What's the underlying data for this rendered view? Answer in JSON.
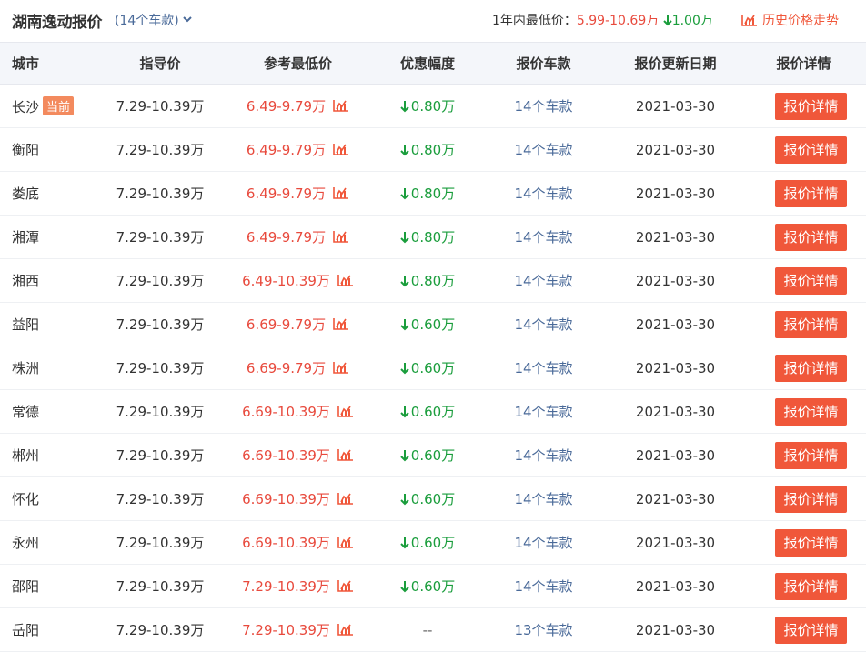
{
  "header": {
    "title": "湖南逸动报价",
    "models_count": "(14个车款)",
    "lowest_label": "1年内最低价：",
    "lowest_range": "5.99-10.69万",
    "lowest_drop": "1.00万",
    "history_label": "历史价格走势"
  },
  "table": {
    "columns": [
      "城市",
      "指导价",
      "参考最低价",
      "优惠幅度",
      "报价车款",
      "报价更新日期",
      "报价详情"
    ],
    "current_badge": "当前",
    "detail_label": "报价详情",
    "rows": [
      {
        "city": "长沙",
        "current": true,
        "guide": "7.29-10.39万",
        "ref": "6.49-9.79万",
        "discount": "0.80万",
        "has_discount": true,
        "models": "14个车款",
        "date": "2021-03-30"
      },
      {
        "city": "衡阳",
        "current": false,
        "guide": "7.29-10.39万",
        "ref": "6.49-9.79万",
        "discount": "0.80万",
        "has_discount": true,
        "models": "14个车款",
        "date": "2021-03-30"
      },
      {
        "city": "娄底",
        "current": false,
        "guide": "7.29-10.39万",
        "ref": "6.49-9.79万",
        "discount": "0.80万",
        "has_discount": true,
        "models": "14个车款",
        "date": "2021-03-30"
      },
      {
        "city": "湘潭",
        "current": false,
        "guide": "7.29-10.39万",
        "ref": "6.49-9.79万",
        "discount": "0.80万",
        "has_discount": true,
        "models": "14个车款",
        "date": "2021-03-30"
      },
      {
        "city": "湘西",
        "current": false,
        "guide": "7.29-10.39万",
        "ref": "6.49-10.39万",
        "discount": "0.80万",
        "has_discount": true,
        "models": "14个车款",
        "date": "2021-03-30"
      },
      {
        "city": "益阳",
        "current": false,
        "guide": "7.29-10.39万",
        "ref": "6.69-9.79万",
        "discount": "0.60万",
        "has_discount": true,
        "models": "14个车款",
        "date": "2021-03-30"
      },
      {
        "city": "株洲",
        "current": false,
        "guide": "7.29-10.39万",
        "ref": "6.69-9.79万",
        "discount": "0.60万",
        "has_discount": true,
        "models": "14个车款",
        "date": "2021-03-30"
      },
      {
        "city": "常德",
        "current": false,
        "guide": "7.29-10.39万",
        "ref": "6.69-10.39万",
        "discount": "0.60万",
        "has_discount": true,
        "models": "14个车款",
        "date": "2021-03-30"
      },
      {
        "city": "郴州",
        "current": false,
        "guide": "7.29-10.39万",
        "ref": "6.69-10.39万",
        "discount": "0.60万",
        "has_discount": true,
        "models": "14个车款",
        "date": "2021-03-30"
      },
      {
        "city": "怀化",
        "current": false,
        "guide": "7.29-10.39万",
        "ref": "6.69-10.39万",
        "discount": "0.60万",
        "has_discount": true,
        "models": "14个车款",
        "date": "2021-03-30"
      },
      {
        "city": "永州",
        "current": false,
        "guide": "7.29-10.39万",
        "ref": "6.69-10.39万",
        "discount": "0.60万",
        "has_discount": true,
        "models": "14个车款",
        "date": "2021-03-30"
      },
      {
        "city": "邵阳",
        "current": false,
        "guide": "7.29-10.39万",
        "ref": "7.29-10.39万",
        "discount": "0.60万",
        "has_discount": true,
        "models": "14个车款",
        "date": "2021-03-30"
      },
      {
        "city": "岳阳",
        "current": false,
        "guide": "7.29-10.39万",
        "ref": "7.29-10.39万",
        "discount": "--",
        "has_discount": false,
        "models": "13个车款",
        "date": "2021-03-30"
      }
    ]
  },
  "colors": {
    "accent": "#f0573a",
    "price_red": "#e84a3d",
    "discount_green": "#1a9d3c",
    "link_blue": "#4a6a99",
    "badge_orange": "#f38a5e",
    "header_bg": "#f4f6fa"
  },
  "icons": {
    "trend": "chart-icon",
    "down_arrow": "arrow-down-icon",
    "chevron": "chevron-down-icon"
  }
}
